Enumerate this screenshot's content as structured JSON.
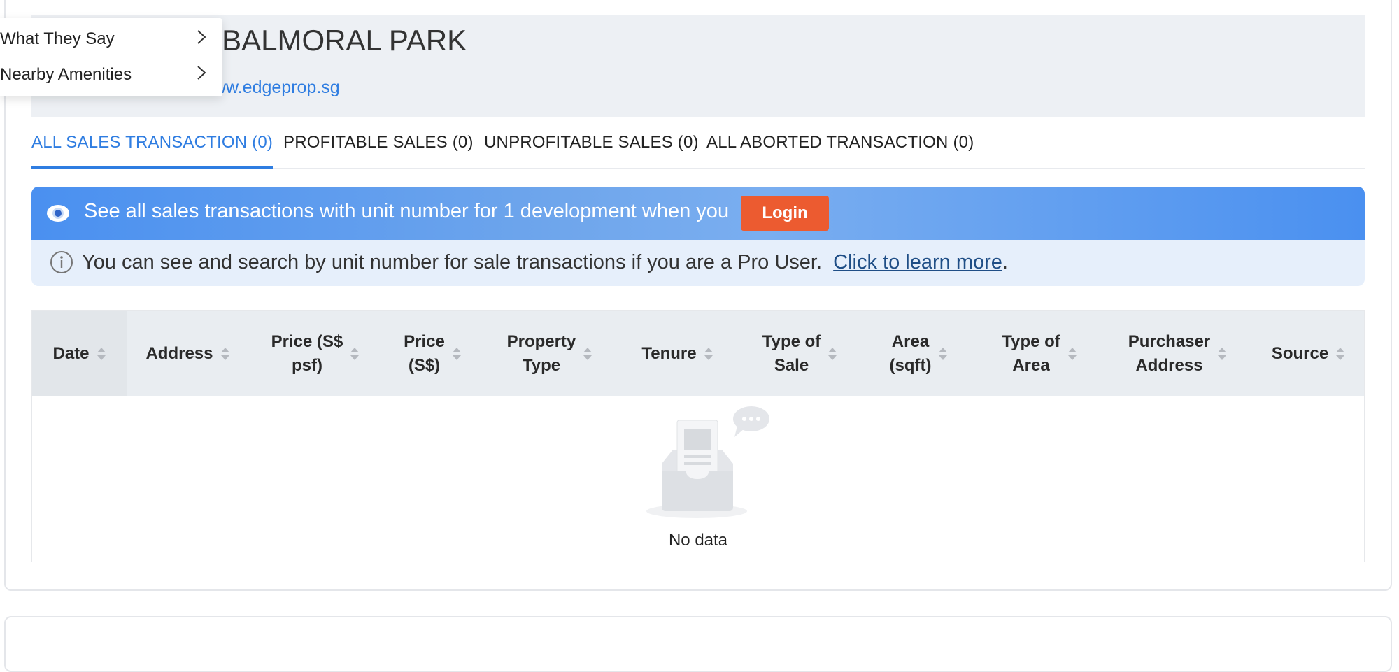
{
  "page": {
    "title_visible": "ction of BALMORAL PARK",
    "source_link": "ww.edgeprop.sg"
  },
  "dropdown": {
    "items": [
      {
        "label": "What They Say",
        "icon": "chevron-right-icon"
      },
      {
        "label": "Nearby Amenities",
        "icon": "chevron-right-icon"
      }
    ]
  },
  "tabs": [
    {
      "label": "ALL SALES TRANSACTION (0)",
      "active": true
    },
    {
      "label": "PROFITABLE SALES (0)",
      "active": false
    },
    {
      "label": "UNPROFITABLE SALES (0)",
      "active": false
    },
    {
      "label": "ALL ABORTED TRANSACTION (0)",
      "active": false
    }
  ],
  "banner": {
    "text": "See all sales transactions with unit number for 1 development when you",
    "login_label": "Login",
    "icon": "eye-icon"
  },
  "info": {
    "text": "You can see and search by unit number for sale transactions if you are a Pro User.",
    "link_text": "Click to learn more",
    "suffix": ".",
    "icon": "info-icon"
  },
  "table": {
    "columns": [
      {
        "line1": "Date",
        "line2": ""
      },
      {
        "line1": "Address",
        "line2": ""
      },
      {
        "line1": "Price (S$",
        "line2": "psf)"
      },
      {
        "line1": "Price",
        "line2": "(S$)"
      },
      {
        "line1": "Property",
        "line2": "Type"
      },
      {
        "line1": "Tenure",
        "line2": ""
      },
      {
        "line1": "Type of",
        "line2": "Sale"
      },
      {
        "line1": "Area",
        "line2": "(sqft)"
      },
      {
        "line1": "Type of",
        "line2": "Area"
      },
      {
        "line1": "Purchaser",
        "line2": "Address"
      },
      {
        "line1": "Source",
        "line2": ""
      }
    ],
    "empty_text": "No data"
  },
  "colors": {
    "accent": "#2f7de1",
    "login": "#ec5b30",
    "banner": "#4a90f0",
    "info_bg": "#e6effb"
  }
}
